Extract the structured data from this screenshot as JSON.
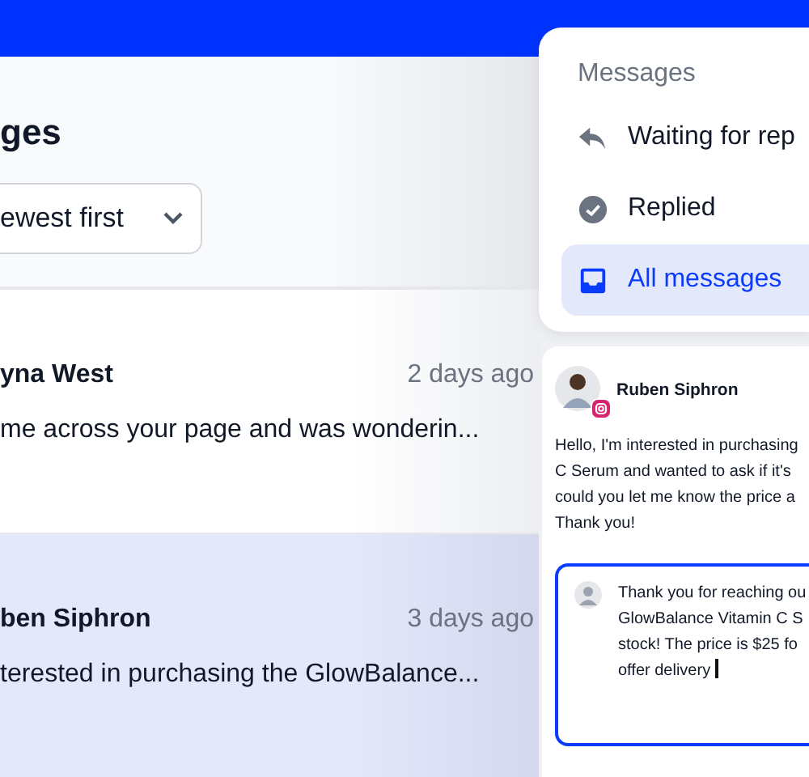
{
  "page": {
    "heading": "ges",
    "sort": {
      "value": "ewest first"
    }
  },
  "conversations": [
    {
      "name": "yna West",
      "time": "2 days ago",
      "preview": "me across your page and was wonderin...",
      "selected": false
    },
    {
      "name": "ben Siphron",
      "time": "3 days ago",
      "preview": "terested in purchasing the GlowBalance...",
      "selected": true
    }
  ],
  "filter_menu": {
    "title": "Messages",
    "items": [
      {
        "kind": "reply",
        "label": "Waiting for rep",
        "selected": false
      },
      {
        "kind": "check",
        "label": "Replied",
        "selected": false
      },
      {
        "kind": "inbox",
        "label": "All messages",
        "selected": true
      }
    ]
  },
  "message": {
    "sender": "Ruben Siphron",
    "lines": [
      "Hello, I'm interested in purchasing",
      "C Serum and wanted to ask if it's",
      "could you let me know the price a",
      "Thank you!"
    ],
    "reply": {
      "lines": [
        "Thank you for reaching ou",
        "GlowBalance Vitamin C S",
        "stock! The price is $25 fo",
        "offer delivery"
      ]
    }
  }
}
